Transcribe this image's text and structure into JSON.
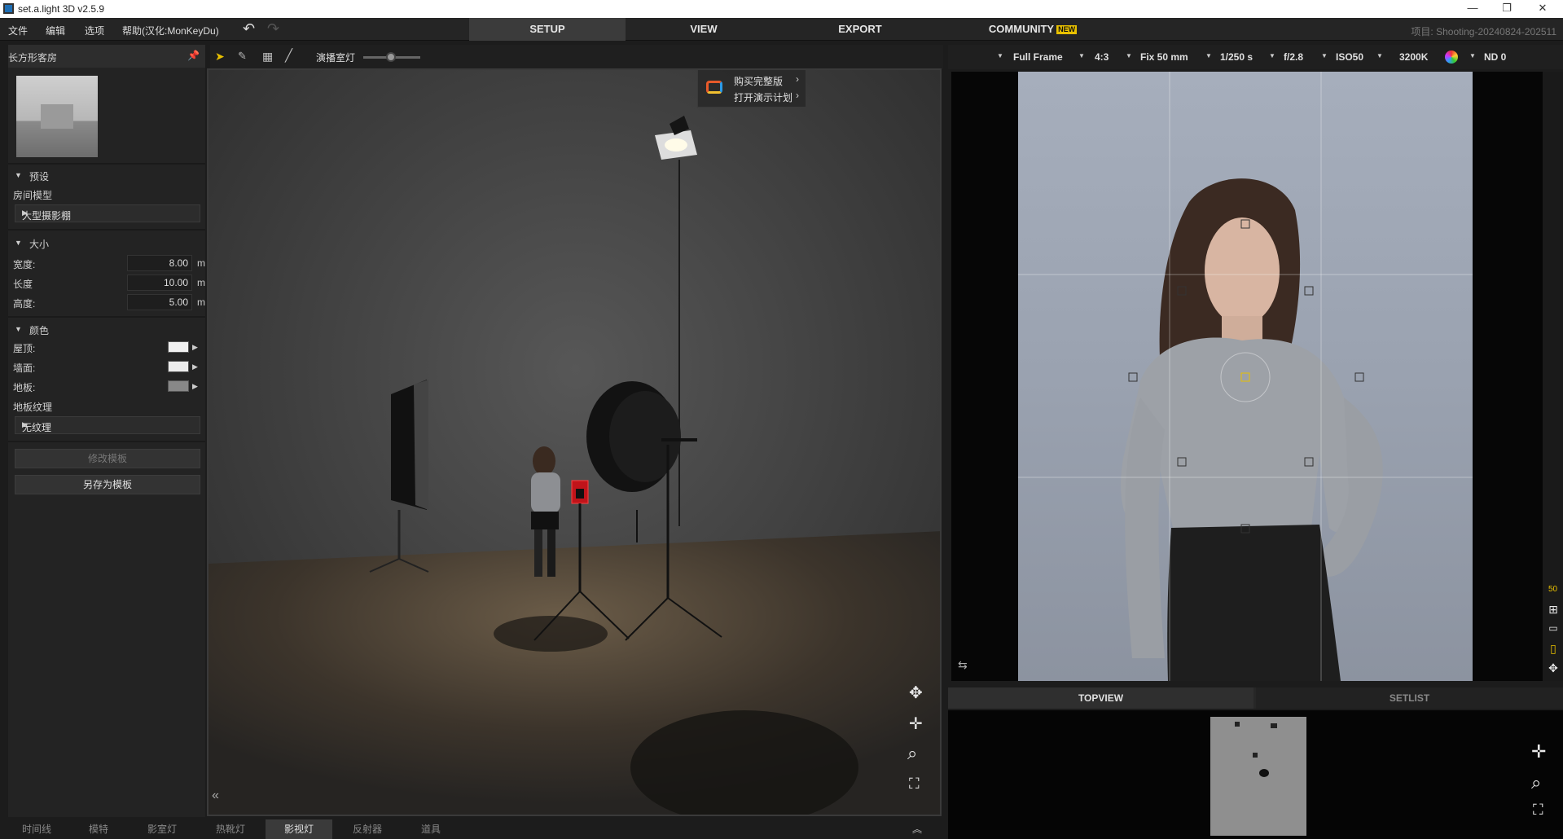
{
  "window": {
    "title": "set.a.light 3D v2.5.9"
  },
  "menu": {
    "items": [
      "文件",
      "编辑",
      "选项",
      "帮助(汉化:MonKeyDu)"
    ]
  },
  "nav": {
    "setup": "SETUP",
    "view": "VIEW",
    "export": "EXPORT",
    "community": "COMMUNITY",
    "new_badge": "NEW"
  },
  "project_label": "项目: Shooting-20240824-202511",
  "left_panel": {
    "header": "长方形客房",
    "preset": {
      "title": "预设",
      "room_model_label": "房间模型",
      "room_model_value": "大型摄影棚"
    },
    "size": {
      "title": "大小",
      "fields": [
        {
          "label": "宽度:",
          "value": "8.00",
          "unit": "m"
        },
        {
          "label": "长度",
          "value": "10.00",
          "unit": "m"
        },
        {
          "label": "高度:",
          "value": "5.00",
          "unit": "m"
        }
      ]
    },
    "color": {
      "title": "颜色",
      "ceiling_label": "屋顶:",
      "wall_label": "墙面:",
      "floor_label": "地板:",
      "ceiling_color": "#f0f0f0",
      "wall_color": "#ececec",
      "floor_color": "#888888",
      "texture_label": "地板纹理",
      "texture_value": "无纹理"
    },
    "buttons": {
      "edit_template": "修改模板",
      "save_template": "另存为模板"
    }
  },
  "viewport_toolbar": {
    "room_light_label": "演播室灯"
  },
  "promo": {
    "buy": "购买完整版",
    "demo": "打开演示计划"
  },
  "bottom_tabs": [
    "时间线",
    "模特",
    "影室灯",
    "热靴灯",
    "影视灯",
    "反射器",
    "道具"
  ],
  "bottom_active": "影视灯",
  "camera_settings": {
    "sensor": "Full Frame",
    "ratio": "4:3",
    "lens": "Fix 50 mm",
    "shutter": "1/250 s",
    "aperture": "f/2.8",
    "iso": "ISO50",
    "kelvin": "3200K",
    "nd": "ND 0"
  },
  "focal_indicator": "50",
  "right_tabs": {
    "topview": "TOPVIEW",
    "setlist": "SETLIST"
  }
}
